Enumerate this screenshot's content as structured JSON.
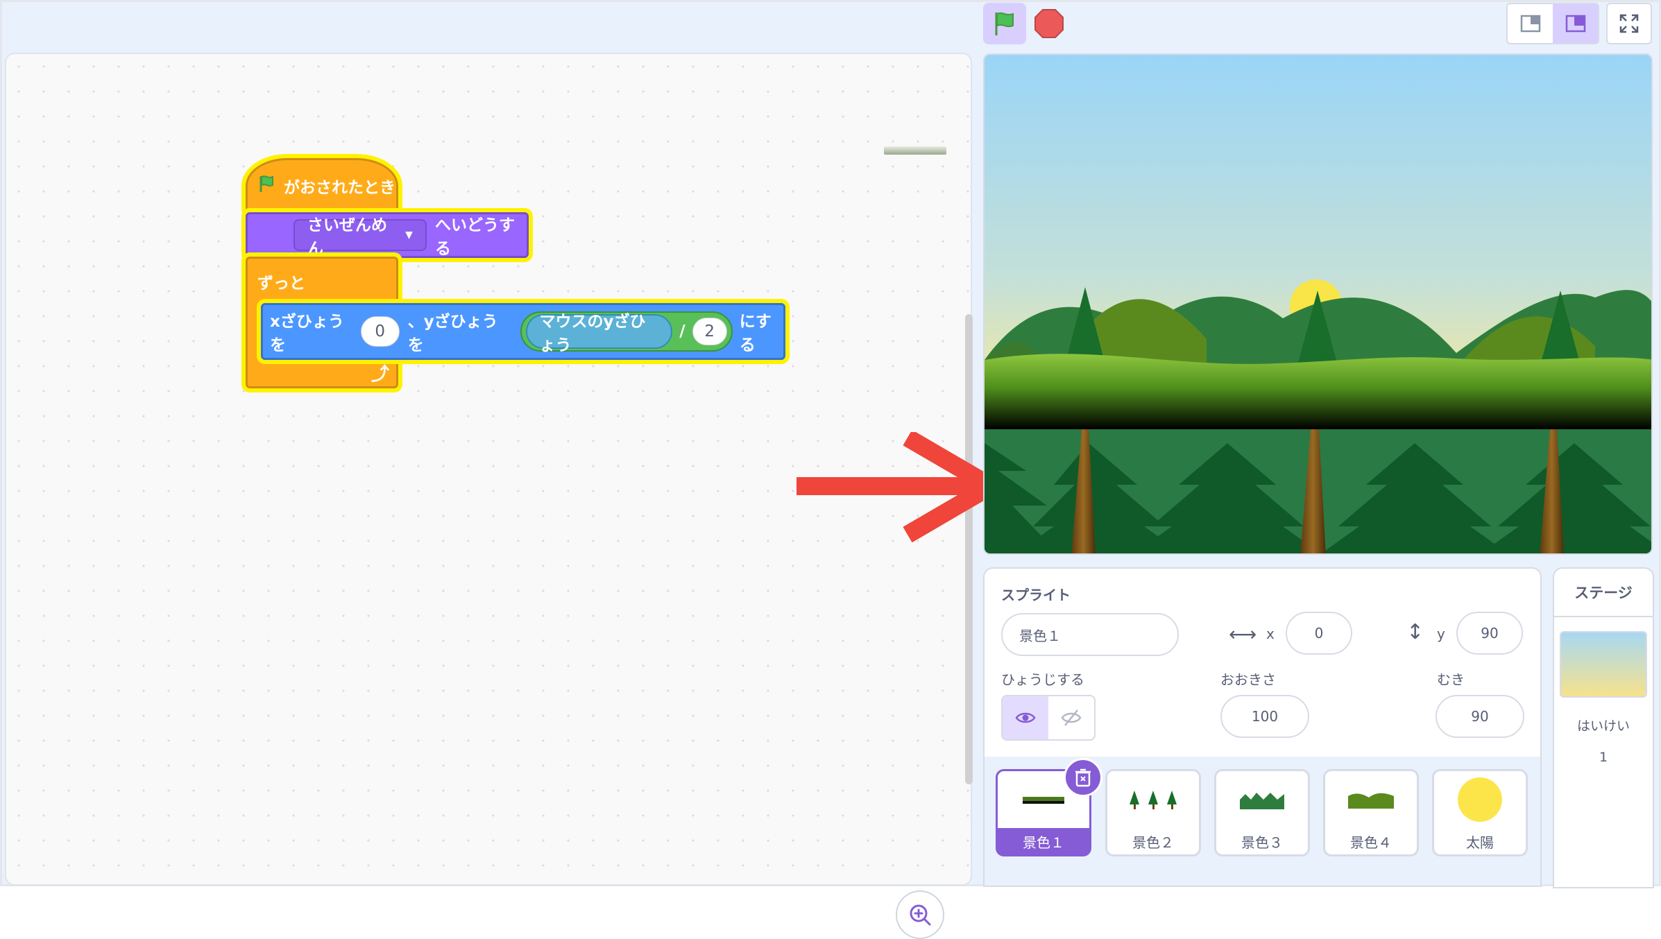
{
  "code": {
    "hat_label": "がおされたとき",
    "goto_target": "さいぜんめん",
    "goto_suffix": "へいどうする",
    "forever_label": "ずっと",
    "setxy_prefix": "xざひょうを",
    "setxy_x": "0",
    "setxy_mid": "、yざひょうを",
    "sensing_label": "マウスのyざひょう",
    "divide_op": "/",
    "divisor": "2",
    "setxy_suffix": "にする"
  },
  "sprite_info": {
    "sprite_label": "スプライト",
    "sprite_name": "景色１",
    "x_label": "x",
    "x_value": "0",
    "y_label": "y",
    "y_value": "90",
    "show_label": "ひょうじする",
    "size_label": "おおきさ",
    "size_value": "100",
    "direction_label": "むき",
    "direction_value": "90"
  },
  "sprites": [
    {
      "name": "景色１",
      "selected": true,
      "thumb": "ground-line"
    },
    {
      "name": "景色２",
      "selected": false,
      "thumb": "trees"
    },
    {
      "name": "景色３",
      "selected": false,
      "thumb": "hills-dark"
    },
    {
      "name": "景色４",
      "selected": false,
      "thumb": "hills-light"
    },
    {
      "name": "太陽",
      "selected": false,
      "thumb": "sun"
    }
  ],
  "stage_panel": {
    "title": "ステージ",
    "backdrop_label": "はいけい",
    "backdrop_count": "1"
  },
  "colors": {
    "events": "#ffab19",
    "looks": "#9966ff",
    "motion": "#4c97ff",
    "operators": "#59c059",
    "sensing": "#5cb1d6",
    "highlight": "#fff200",
    "arrow": "#f0453a"
  }
}
